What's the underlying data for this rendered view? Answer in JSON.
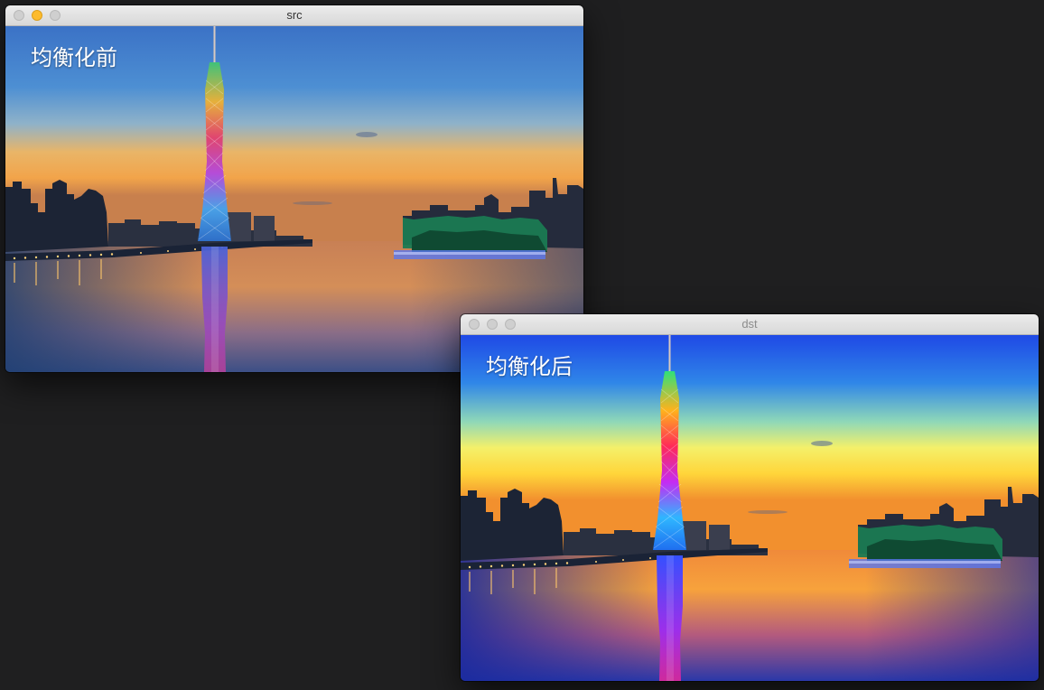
{
  "windows": {
    "src": {
      "title": "src",
      "caption": "均衡化前"
    },
    "dst": {
      "title": "dst",
      "caption": "均衡化后"
    }
  },
  "colors": {
    "desktop": "#1f1f20",
    "titlebar": "#e2e2e2",
    "minimize_active": "#fdbb2d"
  }
}
